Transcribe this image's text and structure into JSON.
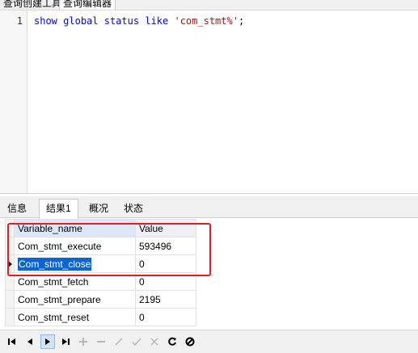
{
  "top_tabs": [
    {
      "label": "查询创建工具"
    },
    {
      "label": "查询编辑器"
    }
  ],
  "editor": {
    "line_number": "1",
    "sql": {
      "kw_show": "show",
      "kw_global": "global",
      "kw_status": "status",
      "kw_like": "like",
      "pattern": "'com_stmt%'",
      "terminator": ";"
    }
  },
  "result_tabs": [
    {
      "label": "信息"
    },
    {
      "label": "结果1"
    },
    {
      "label": "概况"
    },
    {
      "label": "状态"
    }
  ],
  "grid": {
    "columns": [
      "Variable_name",
      "Value"
    ],
    "rows": [
      {
        "name": "Com_stmt_execute",
        "value": "593496"
      },
      {
        "name": "Com_stmt_close",
        "value": "0"
      },
      {
        "name": "Com_stmt_fetch",
        "value": "0"
      },
      {
        "name": "Com_stmt_prepare",
        "value": "2195"
      },
      {
        "name": "Com_stmt_reset",
        "value": "0"
      }
    ]
  },
  "navbar": {
    "buttons": [
      "first-record-icon",
      "prev-record-icon",
      "next-record-icon",
      "last-record-icon",
      "add-record-icon",
      "delete-record-icon",
      "edit-record-icon",
      "apply-icon",
      "cancel-icon",
      "refresh-icon",
      "stop-icon"
    ]
  }
}
